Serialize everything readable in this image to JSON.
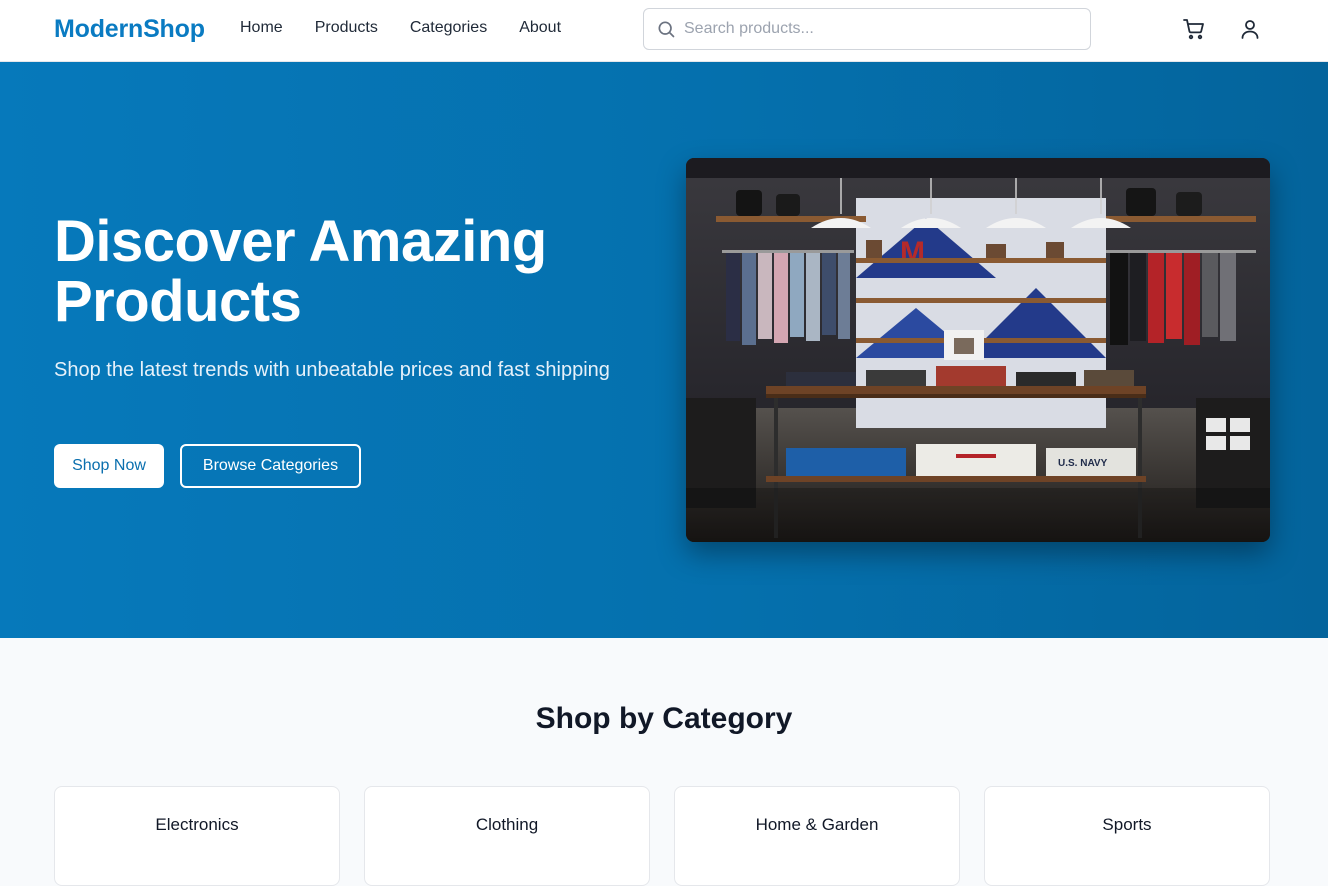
{
  "header": {
    "logo": "ModernShop",
    "nav": [
      {
        "label": "Home"
      },
      {
        "label": "Products"
      },
      {
        "label": "Categories"
      },
      {
        "label": "About"
      }
    ],
    "search": {
      "placeholder": "Search products...",
      "value": ""
    },
    "icons": {
      "search": "search-icon",
      "cart": "cart-icon",
      "user": "user-icon"
    }
  },
  "hero": {
    "title": "Discover Amazing Products",
    "subtitle": "Shop the latest trends with unbeatable prices and fast shipping",
    "primary_button": "Shop Now",
    "secondary_button": "Browse Categories",
    "image_label": "U.S. NAVY",
    "image_letter": "M",
    "background_color": "#0679bb",
    "image_alt": "clothing store interior"
  },
  "categories": {
    "title": "Shop by Category",
    "items": [
      {
        "label": "Electronics"
      },
      {
        "label": "Clothing"
      },
      {
        "label": "Home & Garden"
      },
      {
        "label": "Sports"
      }
    ]
  },
  "colors": {
    "brand": "#0a7bc2",
    "hero_bg": "#0679bb",
    "page_bg": "#f8fafc"
  }
}
